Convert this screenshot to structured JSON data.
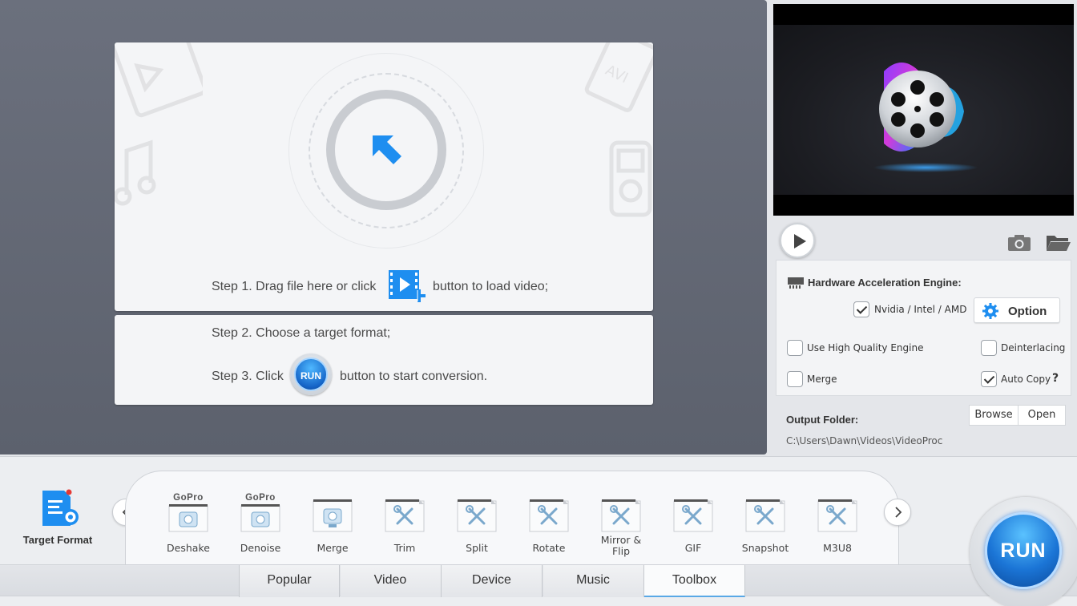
{
  "drop_area": {
    "step1_before": "Step 1. Drag file here or click",
    "step1_after": "button to load video;",
    "step2": "Step 2. Choose a target format;",
    "step3_before": "Step 3. Click",
    "step3_after": "button to start conversion.",
    "inline_run_label": "RUN"
  },
  "settings": {
    "hw_title": "Hardware Acceleration Engine:",
    "nvidia_label": "Nvidia / Intel / AMD",
    "nvidia_checked": true,
    "option_label": "Option",
    "high_quality_label": "Use High Quality Engine",
    "high_quality_checked": false,
    "deinterlacing_label": "Deinterlacing",
    "deinterlacing_checked": false,
    "merge_label": "Merge",
    "merge_checked": false,
    "auto_copy_label": "Auto Copy",
    "auto_copy_checked": true,
    "help_label": "?"
  },
  "output": {
    "title": "Output Folder:",
    "path": "C:\\Users\\Dawn\\Videos\\VideoProc",
    "browse_label": "Browse",
    "open_label": "Open"
  },
  "target_format": {
    "label": "Target Format"
  },
  "tools": [
    {
      "label": "Deshake",
      "icon": "gopro",
      "brand": "GoPro"
    },
    {
      "label": "Denoise",
      "icon": "gopro",
      "brand": "GoPro"
    },
    {
      "label": "Merge",
      "icon": "merge"
    },
    {
      "label": "Trim",
      "icon": "tools"
    },
    {
      "label": "Split",
      "icon": "tools"
    },
    {
      "label": "Rotate",
      "icon": "tools"
    },
    {
      "label": "Mirror &\nFlip",
      "icon": "tools"
    },
    {
      "label": "GIF",
      "icon": "tools"
    },
    {
      "label": "Snapshot",
      "icon": "tools"
    },
    {
      "label": "M3U8",
      "icon": "tools"
    }
  ],
  "tabs": [
    {
      "label": "Popular",
      "active": false
    },
    {
      "label": "Video",
      "active": false
    },
    {
      "label": "Device",
      "active": false
    },
    {
      "label": "Music",
      "active": false
    },
    {
      "label": "Toolbox",
      "active": true
    }
  ],
  "run_button": {
    "label": "RUN"
  },
  "colors": {
    "accent": "#1e8ef0",
    "run_blue": "#1b75d6",
    "drop_bg": "#62677a",
    "active_tab_underline": "#59a8e6"
  }
}
